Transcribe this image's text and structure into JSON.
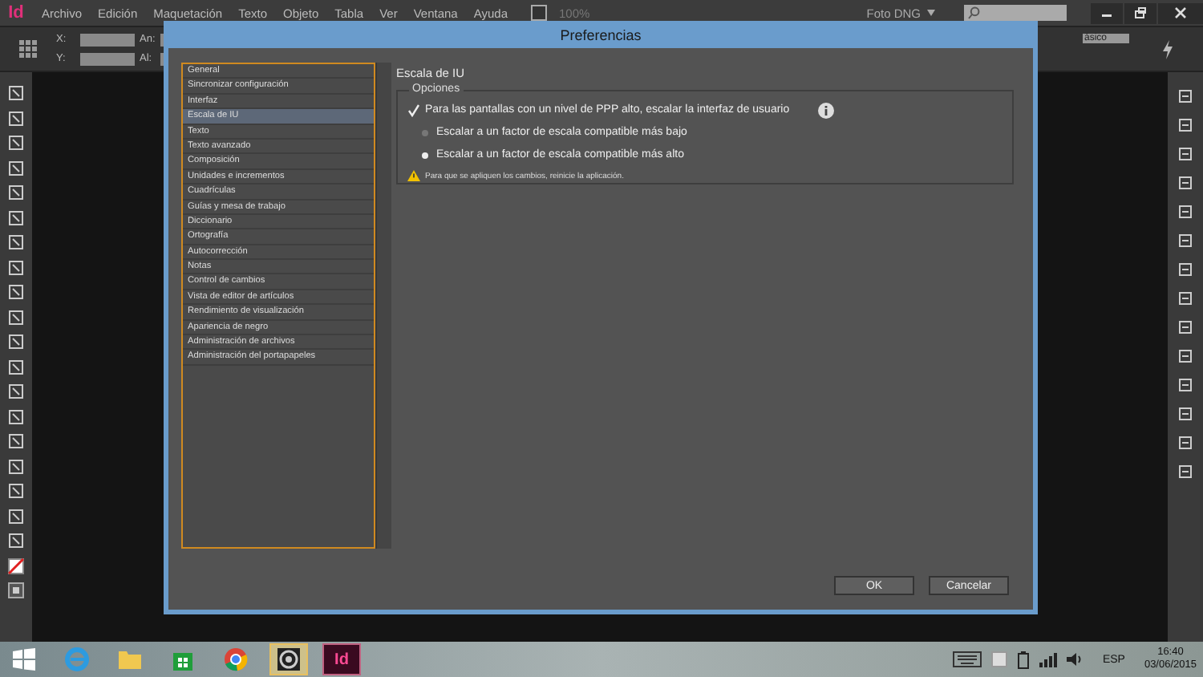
{
  "app": {
    "logo": "Id",
    "menu": [
      "Archivo",
      "Edición",
      "Maquetación",
      "Texto",
      "Objeto",
      "Tabla",
      "Ver",
      "Ventana",
      "Ayuda"
    ],
    "zoom": "100%",
    "workspace": "Foto DNG",
    "style_field": "ásico"
  },
  "control_bar": {
    "labels": [
      "X:",
      "Y:",
      "An:",
      "Al:"
    ]
  },
  "dialog": {
    "title": "Preferencias",
    "categories": [
      {
        "label": "General",
        "selected": false
      },
      {
        "label": "Sincronizar configuración",
        "selected": false
      },
      {
        "label": "Interfaz",
        "selected": false
      },
      {
        "label": "Escala de IU",
        "selected": true
      },
      {
        "label": "Texto",
        "selected": false
      },
      {
        "label": "Texto avanzado",
        "selected": false
      },
      {
        "label": "Composición",
        "selected": false
      },
      {
        "label": "Unidades e incrementos",
        "selected": false
      },
      {
        "label": "Cuadrículas",
        "selected": false
      },
      {
        "label": "Guías y mesa de trabajo",
        "selected": false
      },
      {
        "label": "Diccionario",
        "selected": false
      },
      {
        "label": "Ortografía",
        "selected": false
      },
      {
        "label": "Autocorrección",
        "selected": false
      },
      {
        "label": "Notas",
        "selected": false
      },
      {
        "label": "Control de cambios",
        "selected": false
      },
      {
        "label": "Vista de editor de artículos",
        "selected": false
      },
      {
        "label": "Rendimiento de visualización",
        "selected": false
      },
      {
        "label": "Apariencia de negro",
        "selected": false
      },
      {
        "label": "Administración de archivos",
        "selected": false
      },
      {
        "label": "Administración del portapapeles",
        "selected": false
      }
    ],
    "section_title": "Escala de IU",
    "group_title": "Opciones",
    "checkbox": {
      "label": "Para las pantallas con un nivel de PPP alto, escalar la interfaz de usuario",
      "checked": true
    },
    "radios": [
      {
        "label": "Escalar a un factor de escala compatible más bajo",
        "selected": false
      },
      {
        "label": "Escalar a un factor de escala compatible más alto",
        "selected": true
      }
    ],
    "warning": "Para que se apliquen los cambios, reinicie la aplicación.",
    "buttons": [
      "OK",
      "Cancelar"
    ]
  },
  "taskbar": {
    "apps": [
      {
        "kind": "ie"
      },
      {
        "kind": "folder"
      },
      {
        "kind": "store"
      },
      {
        "kind": "chrome"
      },
      {
        "kind": "media"
      },
      {
        "kind": "indesign",
        "label": "Id"
      }
    ],
    "language": "ESP",
    "time": "16:40",
    "date": "03/06/2015"
  }
}
